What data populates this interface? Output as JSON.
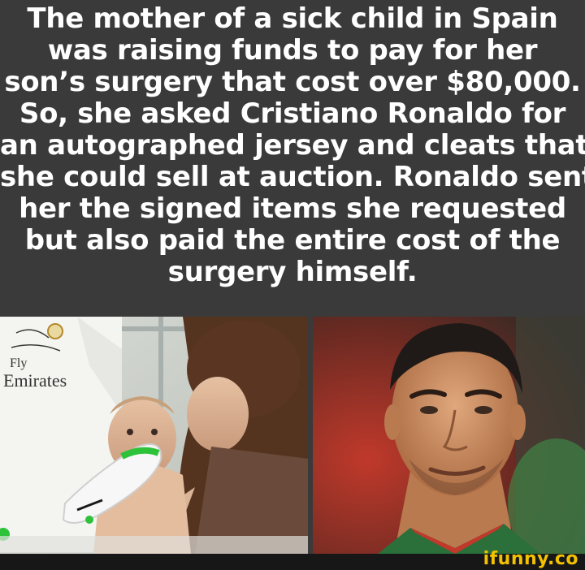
{
  "caption": {
    "lines": [
      "The mother of a sick child in Spain",
      "was raising funds to pay for her",
      "son’s surgery that cost over $80,000.",
      "So, she asked Cristiano Ronaldo for",
      "an autographed jersey and cleats that",
      "she could sell at auction. Ronaldo sent",
      "her the signed items she requested",
      "but also paid the entire cost of the",
      "surgery himself."
    ]
  },
  "left_photo": {
    "jersey_text_1": "Fly",
    "jersey_text_2": "Emirates"
  },
  "watermark": "ifunny.co",
  "colors": {
    "background": "#3a3a3a",
    "caption_text": "#ffffff",
    "watermark": "#f2c200",
    "footer": "#171717"
  }
}
